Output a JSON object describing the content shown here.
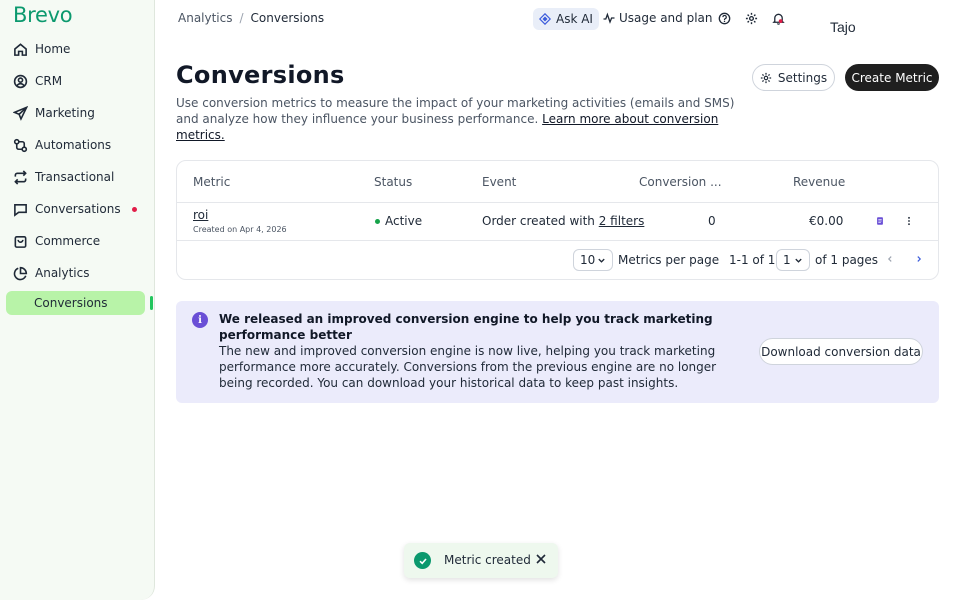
{
  "brand": {
    "logo_text": "Brevo",
    "color": "#0b996e"
  },
  "sidebar": {
    "items": [
      {
        "label": "Home",
        "icon": "home-icon"
      },
      {
        "label": "CRM",
        "icon": "contact-icon"
      },
      {
        "label": "Marketing",
        "icon": "send-icon"
      },
      {
        "label": "Automations",
        "icon": "automation-icon"
      },
      {
        "label": "Transactional",
        "icon": "repeat-icon"
      },
      {
        "label": "Conversations",
        "icon": "chat-icon",
        "notification": true
      },
      {
        "label": "Commerce",
        "icon": "shopping-bag-icon"
      },
      {
        "label": "Analytics",
        "icon": "pie-chart-icon"
      }
    ],
    "active_sub_item": "Conversions",
    "active_color": "#b8f3a8"
  },
  "topbar": {
    "breadcrumb": [
      "Analytics",
      "/",
      "Conversions"
    ],
    "ask_ai_label": "Ask AI",
    "usage_label": "Usage and plan",
    "user_name": "Tajo"
  },
  "header": {
    "title": "Conversions",
    "settings_label": "Settings",
    "create_label": "Create Metric",
    "description": "Use conversion metrics to measure the impact of your marketing activities (emails and SMS) and analyze how they influence your business performance.",
    "learn_more": "Learn more about conversion metrics."
  },
  "table": {
    "columns": [
      "Metric",
      "Status",
      "Event",
      "Conversion ...",
      "Revenue"
    ],
    "rows": [
      {
        "metric": "roi",
        "created": "Created on Apr 4, 2026",
        "status": "Active",
        "event_prefix": "Order created with",
        "event_link": "2 filters",
        "conversions": "0",
        "revenue": "€0.00"
      }
    ],
    "pagination": {
      "per_page": "10",
      "per_page_label": "Metrics per page",
      "range": "1-1 of 1",
      "page": "1",
      "pages_label": "of 1 pages"
    }
  },
  "banner": {
    "icon": "info-icon",
    "title": "We released an improved conversion engine to help you track marketing performance better",
    "body": "The new and improved conversion engine is now live, helping you track marketing performance more accurately. Conversions from the previous engine are no longer being recorded. You can download your historical data to keep past insights.",
    "button_label": "Download conversion data"
  },
  "toast": {
    "message": "Metric created",
    "icon": "check-circle-icon"
  }
}
